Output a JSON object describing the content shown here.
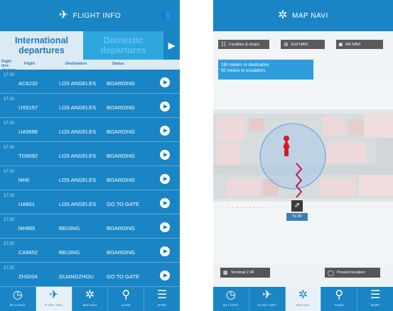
{
  "left": {
    "header_title": "FLIGHT INFO",
    "header_icon": "airplane-icon",
    "header_right_icon": "people-icon",
    "tabs": {
      "international": "International departures",
      "domestic": "Domestic departures"
    },
    "columns": {
      "time": "Flight time changes",
      "flight": "Flight",
      "destination": "Destination",
      "status": "Status"
    },
    "flights": [
      {
        "time": "17:10",
        "flight": "AC6232",
        "destination": "LOS ANGELES",
        "status": "BOARDING"
      },
      {
        "time": "17:10",
        "flight": "US5157",
        "destination": "LOS ANGELES",
        "status": "BOARDING"
      },
      {
        "time": "17:10",
        "flight": "UA9686",
        "destination": "LOS ANGELES",
        "status": "BOARDING"
      },
      {
        "time": "17:10",
        "flight": "TG6092",
        "destination": "LOS ANGELES",
        "status": "BOARDING"
      },
      {
        "time": "17:10",
        "flight": "NH6",
        "destination": "LOS ANGELES",
        "status": "BOARDING"
      },
      {
        "time": "17:15",
        "flight": "UA801",
        "destination": "LOS ANGELES",
        "status": "GO TO GATE"
      },
      {
        "time": "17:20",
        "flight": "NH955",
        "destination": "BEIJING",
        "status": "BOARDING"
      },
      {
        "time": "17:20",
        "flight": "CA8652",
        "destination": "BEIJING",
        "status": "BOARDING"
      },
      {
        "time": "17:20",
        "flight": "ZH3204",
        "destination": "GUANGZHOU",
        "status": "GO TO GATE"
      }
    ]
  },
  "right": {
    "header_title": "MAP NAVI",
    "header_icon": "navi-star-icon",
    "toolbar": {
      "facilities": "Facilities & shops",
      "end_navi": "End NAVI",
      "ar_navi": "AR NAVI"
    },
    "info_lines": [
      "180 meters to destination",
      "50 meters to escalators"
    ],
    "escalator_label": "To 3F",
    "terminal": "Terminal 2 4F",
    "present_location": "Present location"
  },
  "nav": [
    {
      "icon": "clock-icon",
      "label": "MY FLIGHT"
    },
    {
      "icon": "airplane-icon",
      "label": "FLIGHT INFO"
    },
    {
      "icon": "navi-star-icon",
      "label": "MAP NAVI"
    },
    {
      "icon": "search-icon",
      "label": "GUIDE"
    },
    {
      "icon": "menu-icon",
      "label": "MORE"
    }
  ],
  "colors": {
    "primary": "#1a85c4",
    "light": "#ddeaf4",
    "route": "#c2184d"
  }
}
